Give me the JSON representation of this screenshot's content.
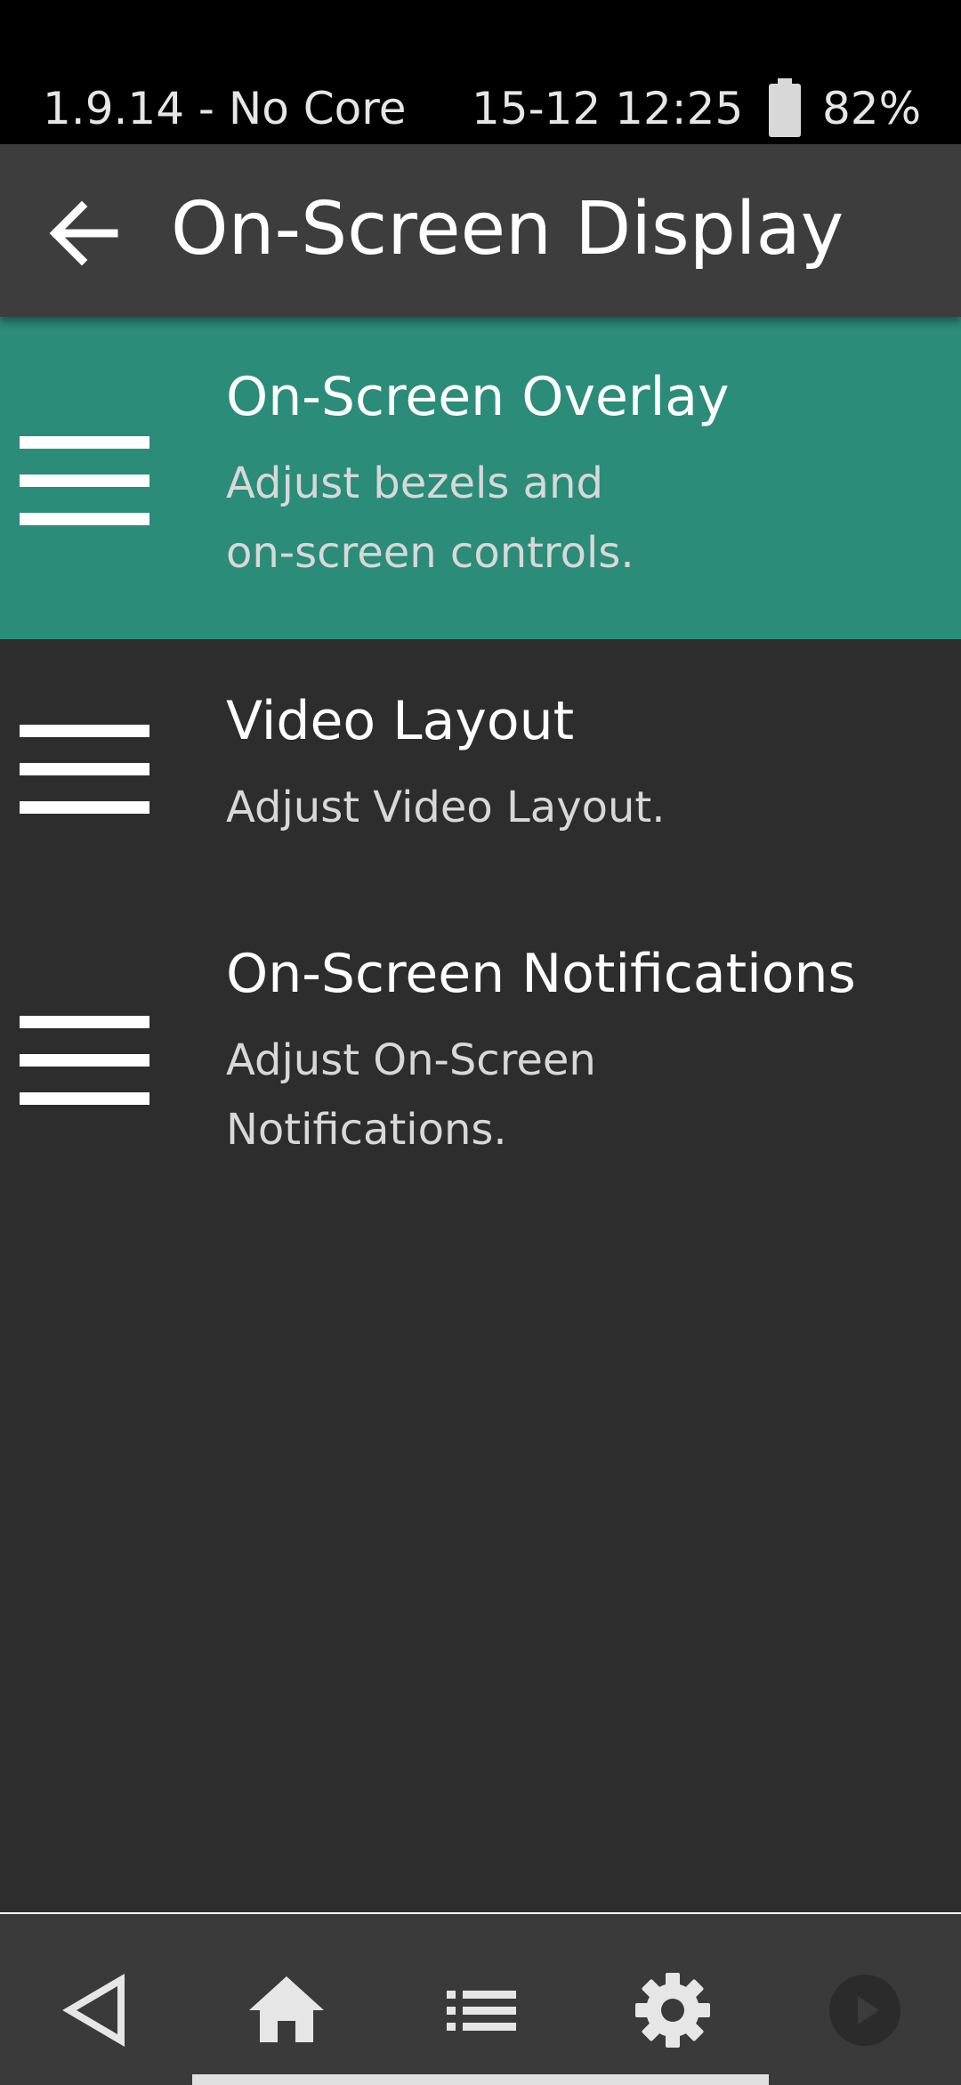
{
  "status_bar": {
    "left_text": "1.9.14 - No Core",
    "datetime": "15-12 12:25",
    "battery_percent": "82%",
    "battery_icon": "battery-icon"
  },
  "app_bar": {
    "back_icon": "arrow-left-icon",
    "title": "On-Screen Display"
  },
  "menu": {
    "items": [
      {
        "title": "On-Screen Overlay",
        "subtitle": "Adjust bezels and\non-screen controls.",
        "icon": "hamburger-icon",
        "selected": true
      },
      {
        "title": "Video Layout",
        "subtitle": "Adjust Video Layout.",
        "icon": "hamburger-icon",
        "selected": false
      },
      {
        "title": "On-Screen Notifications",
        "subtitle": "Adjust On-Screen\nNotifications.",
        "icon": "hamburger-icon",
        "selected": false
      }
    ]
  },
  "nav_bar": {
    "items": [
      "back-triangle-icon",
      "home-icon",
      "list-icon",
      "gear-icon",
      "play-icon"
    ]
  },
  "colors": {
    "selected_item": "#2a8c79",
    "background": "#2d2d2d",
    "app_bar": "#3d3d3d"
  }
}
